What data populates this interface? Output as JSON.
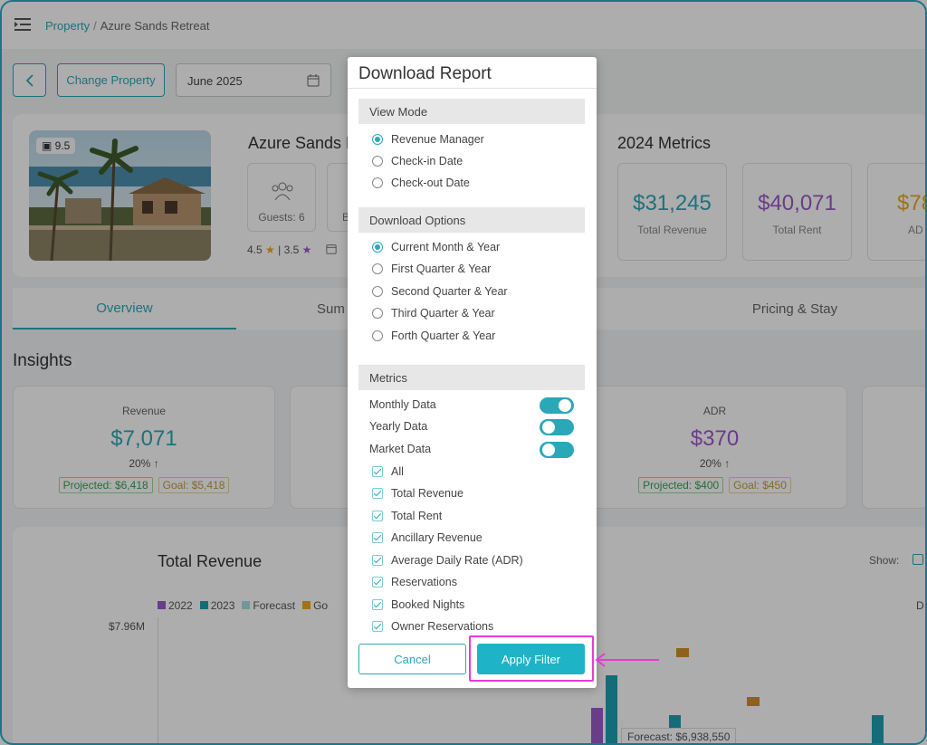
{
  "header": {
    "breadcrumb": [
      "Property",
      "Azure Sands Retreat"
    ],
    "breadcrumb_sep": "/"
  },
  "controls": {
    "change_property": "Change Property",
    "date_value": "June 2025"
  },
  "property": {
    "name": "Azure Sands R",
    "image_badge": "9.5",
    "guests_label": "Guests: 6",
    "bed_label_partial": "B",
    "rating_a": "4.5",
    "rating_sep": "|",
    "rating_b": "3.5"
  },
  "metrics": {
    "title": "2024 Metrics",
    "items": [
      {
        "value": "$31,245",
        "label": "Total Revenue",
        "color": "#2aa8b8"
      },
      {
        "value": "$40,071",
        "label": "Total Rent",
        "color": "#9b5bc9"
      },
      {
        "value": "$78",
        "label": "AD",
        "color": "#f0a81e"
      }
    ]
  },
  "tabs": [
    "Overview",
    "Sum",
    "Pricing & Stay"
  ],
  "insights": {
    "title": "Insights",
    "cards": [
      {
        "label": "Revenue",
        "value": "$7,071",
        "change": "20%",
        "projected": "Projected: $6,418",
        "goal": "Goal: $5,418",
        "color": "#2aa8b8"
      },
      {
        "label": "ADR",
        "value": "$370",
        "change": "20%",
        "projected": "Projected: $400",
        "goal": "Goal: $450",
        "color": "#9b5bc9"
      }
    ]
  },
  "chart": {
    "title": "Total Revenue",
    "show_label": "Show:",
    "legend": [
      {
        "label": "2022",
        "color": "#9b5bc9"
      },
      {
        "label": "2023",
        "color": "#1f9fb3"
      },
      {
        "label": "Forecast",
        "color": "#a9dde4"
      },
      {
        "label": "Go",
        "color": "#f0a81e"
      }
    ],
    "legend_right": "D",
    "y_label": "$7.96M",
    "tooltip": "Forecast: $6,938,550"
  },
  "modal": {
    "title": "Download Report",
    "view_mode": {
      "heading": "View Mode",
      "options": [
        "Revenue Manager",
        "Check-in Date",
        "Check-out Date"
      ],
      "selected": 0
    },
    "download_options": {
      "heading": "Download Options",
      "options": [
        "Current Month & Year",
        "First Quarter & Year",
        "Second Quarter & Year",
        "Third Quarter & Year",
        "Forth Quarter & Year"
      ],
      "selected": 0
    },
    "metrics": {
      "heading": "Metrics",
      "toggles": [
        {
          "label": "Monthly Data",
          "on": true
        },
        {
          "label": "Yearly Data",
          "on": false
        },
        {
          "label": "Market Data",
          "on": false
        }
      ],
      "checks": [
        "All",
        "Total Revenue",
        "Total Rent",
        "Ancillary Revenue",
        "Average Daily Rate (ADR)",
        "Reservations",
        "Booked Nights",
        "Owner Reservations"
      ]
    },
    "cancel_label": "Cancel",
    "apply_label": "Apply Filter"
  },
  "annotation_color": "#e83ad6"
}
